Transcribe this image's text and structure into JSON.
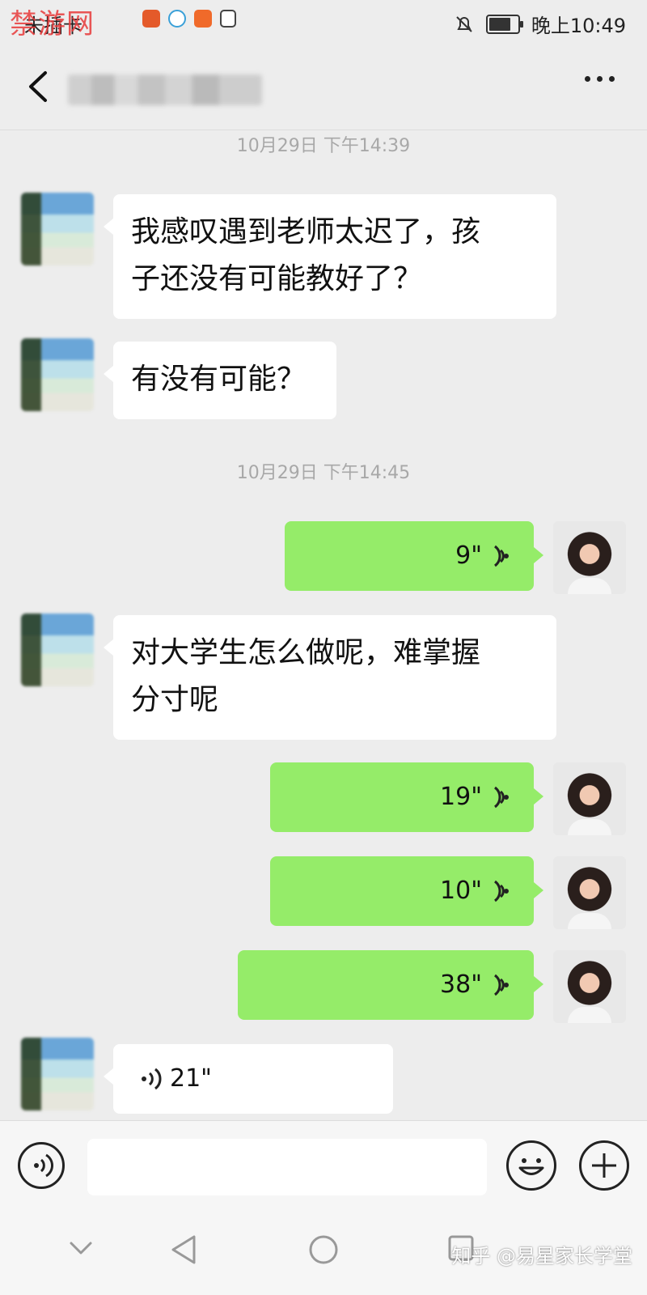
{
  "status_bar": {
    "carrier": "未插卡",
    "time": "晚上10:49",
    "watermark": "禁游网"
  },
  "header": {
    "back_icon": "chevron-left-icon",
    "more_icon": "more-dots-icon"
  },
  "messages": [
    {
      "type": "timestamp",
      "text": "10月29日 下午14:39"
    },
    {
      "type": "text",
      "side": "left",
      "lines": [
        "我感叹遇到老师太迟了，孩",
        "子还没有可能教好了？"
      ]
    },
    {
      "type": "text",
      "side": "left",
      "lines": [
        "有没有可能？"
      ]
    },
    {
      "type": "timestamp",
      "text": "10月29日 下午14:45"
    },
    {
      "type": "voice",
      "side": "right",
      "duration": "9\""
    },
    {
      "type": "text",
      "side": "left",
      "lines": [
        "对大学生怎么做呢，难掌握",
        "分寸呢"
      ]
    },
    {
      "type": "voice",
      "side": "right",
      "duration": "19\""
    },
    {
      "type": "voice",
      "side": "right",
      "duration": "10\""
    },
    {
      "type": "voice",
      "side": "right",
      "duration": "38\""
    },
    {
      "type": "voice",
      "side": "left",
      "duration": "21\""
    }
  ],
  "input_bar": {
    "voice_icon": "voice-icon",
    "emoji_icon": "emoji-icon",
    "plus_icon": "plus-icon"
  },
  "nav_bar": {
    "credit": "知乎 @易星家长学堂"
  },
  "colors": {
    "background": "#ededed",
    "incoming_bubble": "#ffffff",
    "outgoing_bubble": "#95ec69",
    "timestamp_text": "#a8a8a8"
  }
}
